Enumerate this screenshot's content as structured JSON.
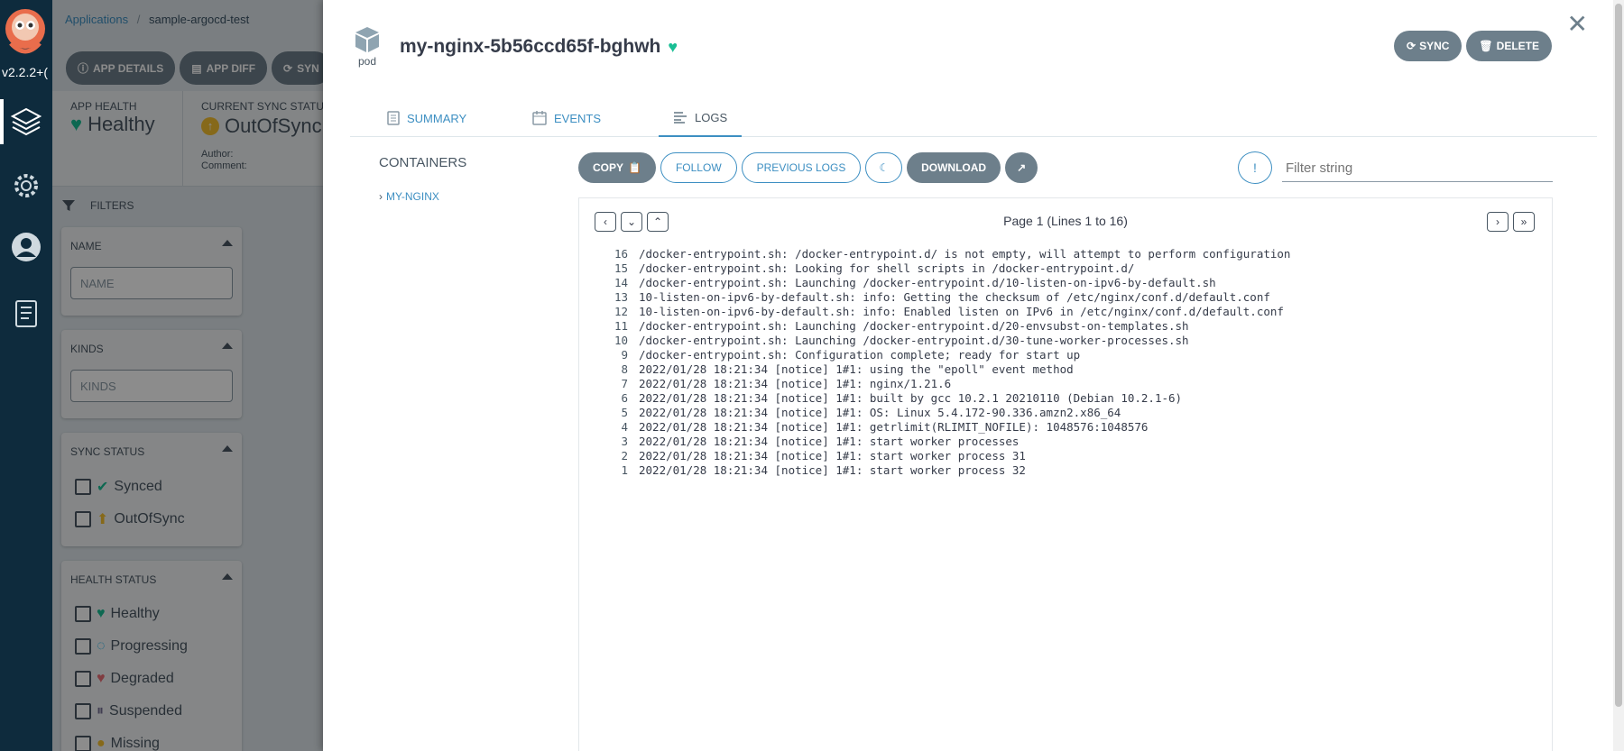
{
  "nav": {
    "version": "v2.2.2+("
  },
  "app": {
    "breadcrumb_root": "Applications",
    "breadcrumb_current": "sample-argocd-test",
    "toolbar": {
      "app_details": "APP DETAILS",
      "app_diff": "APP DIFF",
      "sync": "SYN"
    },
    "status": {
      "health_label": "APP HEALTH",
      "health_value": "Healthy",
      "sync_label": "CURRENT SYNC STATUS",
      "sync_value": "OutOfSync",
      "author_label": "Author:",
      "comment_label": "Comment:"
    },
    "filters": {
      "title": "FILTERS",
      "name_title": "NAME",
      "name_placeholder": "NAME",
      "kinds_title": "KINDS",
      "kinds_placeholder": "KINDS",
      "sync_status_title": "SYNC STATUS",
      "sync_options": [
        "Synced",
        "OutOfSync"
      ],
      "health_status_title": "HEALTH STATUS",
      "health_options": [
        "Healthy",
        "Progressing",
        "Degraded",
        "Suspended",
        "Missing"
      ]
    }
  },
  "panel": {
    "kind": "pod",
    "title": "my-nginx-5b56ccd65f-bghwh",
    "sync_button": "SYNC",
    "delete_button": "DELETE",
    "tabs": [
      "SUMMARY",
      "EVENTS",
      "LOGS"
    ],
    "containers_title": "CONTAINERS",
    "container_item": "MY-NGINX",
    "log_toolbar": {
      "copy": "COPY",
      "follow": "FOLLOW",
      "previous_logs": "PREVIOUS LOGS",
      "download": "DOWNLOAD"
    },
    "filter_placeholder": "Filter string",
    "filter_info": "!",
    "page_text": "Page 1 (Lines 1 to 16)",
    "log_lines": [
      {
        "n": "16",
        "t": "/docker-entrypoint.sh: /docker-entrypoint.d/ is not empty, will attempt to perform configuration"
      },
      {
        "n": "15",
        "t": "/docker-entrypoint.sh: Looking for shell scripts in /docker-entrypoint.d/"
      },
      {
        "n": "14",
        "t": "/docker-entrypoint.sh: Launching /docker-entrypoint.d/10-listen-on-ipv6-by-default.sh"
      },
      {
        "n": "13",
        "t": "10-listen-on-ipv6-by-default.sh: info: Getting the checksum of /etc/nginx/conf.d/default.conf"
      },
      {
        "n": "12",
        "t": "10-listen-on-ipv6-by-default.sh: info: Enabled listen on IPv6 in /etc/nginx/conf.d/default.conf"
      },
      {
        "n": "11",
        "t": "/docker-entrypoint.sh: Launching /docker-entrypoint.d/20-envsubst-on-templates.sh"
      },
      {
        "n": "10",
        "t": "/docker-entrypoint.sh: Launching /docker-entrypoint.d/30-tune-worker-processes.sh"
      },
      {
        "n": "9",
        "t": "/docker-entrypoint.sh: Configuration complete; ready for start up"
      },
      {
        "n": "8",
        "t": "2022/01/28 18:21:34 [notice] 1#1: using the \"epoll\" event method"
      },
      {
        "n": "7",
        "t": "2022/01/28 18:21:34 [notice] 1#1: nginx/1.21.6"
      },
      {
        "n": "6",
        "t": "2022/01/28 18:21:34 [notice] 1#1: built by gcc 10.2.1 20210110 (Debian 10.2.1-6)"
      },
      {
        "n": "5",
        "t": "2022/01/28 18:21:34 [notice] 1#1: OS: Linux 5.4.172-90.336.amzn2.x86_64"
      },
      {
        "n": "4",
        "t": "2022/01/28 18:21:34 [notice] 1#1: getrlimit(RLIMIT_NOFILE): 1048576:1048576"
      },
      {
        "n": "3",
        "t": "2022/01/28 18:21:34 [notice] 1#1: start worker processes"
      },
      {
        "n": "2",
        "t": "2022/01/28 18:21:34 [notice] 1#1: start worker process 31"
      },
      {
        "n": "1",
        "t": "2022/01/28 18:21:34 [notice] 1#1: start worker process 32"
      }
    ]
  },
  "colors": {
    "nav_bg": "#0e2b3d",
    "accent": "#3d8fc2",
    "healthy": "#18be94",
    "out_of_sync": "#f4c030",
    "degraded": "#e96d76"
  }
}
